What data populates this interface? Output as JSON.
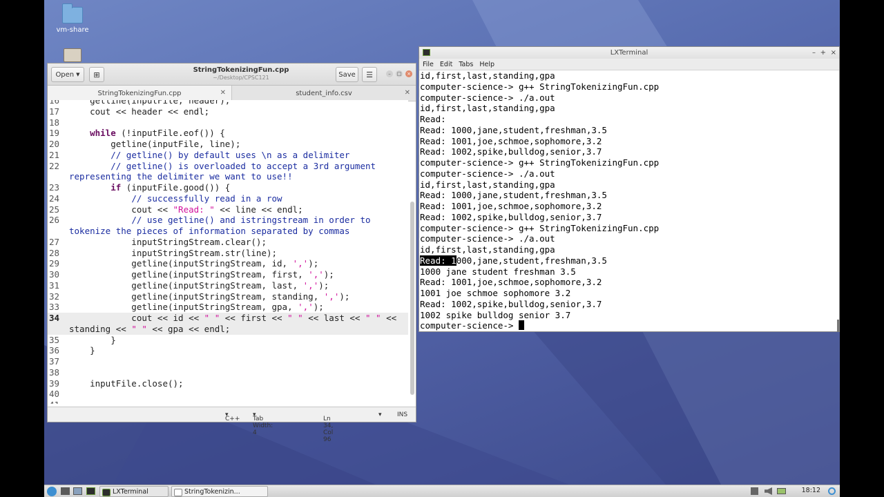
{
  "desktop": {
    "icons": [
      {
        "label": "vm-share",
        "name": "folder-icon"
      }
    ]
  },
  "gedit": {
    "open_label": "Open",
    "title": "StringTokenizingFun.cpp",
    "path": "~/Desktop/CPSC121",
    "save_label": "Save",
    "tabs": [
      {
        "label": "StringTokenizingFun.cpp",
        "active": true
      },
      {
        "label": "student_info.csv",
        "active": false
      }
    ],
    "status": {
      "language": "C++",
      "tab_width": "Tab Width: 4",
      "position": "Ln 34, Col 96",
      "mode": "INS"
    },
    "code_lines": [
      {
        "n": "16",
        "segs": [
          [
            "",
            "    getline(inputFile, header);"
          ]
        ]
      },
      {
        "n": "17",
        "segs": [
          [
            "",
            "    cout << header << endl;"
          ]
        ]
      },
      {
        "n": "18",
        "segs": [
          [
            "",
            ""
          ]
        ]
      },
      {
        "n": "19",
        "segs": [
          [
            "",
            "    "
          ],
          [
            "kw",
            "while"
          ],
          [
            "",
            " (!inputFile.eof()) {"
          ]
        ]
      },
      {
        "n": "20",
        "segs": [
          [
            "",
            "        getline(inputFile, line);"
          ]
        ]
      },
      {
        "n": "21",
        "segs": [
          [
            "",
            "        "
          ],
          [
            "cm",
            "// getline() by default uses \\n as a delimiter"
          ]
        ]
      },
      {
        "n": "22",
        "segs": [
          [
            "",
            "        "
          ],
          [
            "cm",
            "// getline() is overloaded to accept a 3rd argument"
          ]
        ]
      },
      {
        "n": "",
        "segs": [
          [
            "cm",
            "representing the delimiter we want to use!!"
          ]
        ]
      },
      {
        "n": "23",
        "segs": [
          [
            "",
            "        "
          ],
          [
            "kw",
            "if"
          ],
          [
            "",
            " (inputFile.good()) {"
          ]
        ]
      },
      {
        "n": "24",
        "segs": [
          [
            "",
            "            "
          ],
          [
            "cm",
            "// successfully read in a row"
          ]
        ]
      },
      {
        "n": "25",
        "segs": [
          [
            "",
            "            cout << "
          ],
          [
            "st",
            "\"Read: \""
          ],
          [
            "",
            " << line << endl;"
          ]
        ]
      },
      {
        "n": "26",
        "segs": [
          [
            "",
            "            "
          ],
          [
            "cm",
            "// use getline() and istringstream in order to"
          ]
        ]
      },
      {
        "n": "",
        "segs": [
          [
            "cm",
            "tokenize the pieces of information separated by commas"
          ]
        ]
      },
      {
        "n": "27",
        "segs": [
          [
            "",
            "            inputStringStream.clear();"
          ]
        ]
      },
      {
        "n": "28",
        "segs": [
          [
            "",
            "            inputStringStream.str(line);"
          ]
        ]
      },
      {
        "n": "29",
        "segs": [
          [
            "",
            "            getline(inputStringStream, id, "
          ],
          [
            "st",
            "','"
          ],
          [
            "",
            ");"
          ]
        ]
      },
      {
        "n": "30",
        "segs": [
          [
            "",
            "            getline(inputStringStream, first, "
          ],
          [
            "st",
            "','"
          ],
          [
            "",
            ");"
          ]
        ]
      },
      {
        "n": "31",
        "segs": [
          [
            "",
            "            getline(inputStringStream, last, "
          ],
          [
            "st",
            "','"
          ],
          [
            "",
            ");"
          ]
        ]
      },
      {
        "n": "32",
        "segs": [
          [
            "",
            "            getline(inputStringStream, standing, "
          ],
          [
            "st",
            "','"
          ],
          [
            "",
            ");"
          ]
        ]
      },
      {
        "n": "33",
        "segs": [
          [
            "",
            "            getline(inputStringStream, gpa, "
          ],
          [
            "st",
            "','"
          ],
          [
            "",
            ");"
          ]
        ]
      },
      {
        "n": "34",
        "cur": true,
        "segs": [
          [
            "",
            "            cout << id << "
          ],
          [
            "st",
            "\" \""
          ],
          [
            "",
            " << first << "
          ],
          [
            "st",
            "\" \""
          ],
          [
            "",
            " << last << "
          ],
          [
            "st",
            "\" \""
          ],
          [
            "",
            " <<"
          ]
        ]
      },
      {
        "n": "",
        "cur": true,
        "segs": [
          [
            "",
            "standing << "
          ],
          [
            "st",
            "\" \""
          ],
          [
            "",
            " << gpa << endl;"
          ]
        ]
      },
      {
        "n": "35",
        "segs": [
          [
            "",
            "        }"
          ]
        ]
      },
      {
        "n": "36",
        "segs": [
          [
            "",
            "    }"
          ]
        ]
      },
      {
        "n": "37",
        "segs": [
          [
            "",
            ""
          ]
        ]
      },
      {
        "n": "38",
        "segs": [
          [
            "",
            ""
          ]
        ]
      },
      {
        "n": "39",
        "segs": [
          [
            "",
            "    inputFile.close();"
          ]
        ]
      },
      {
        "n": "40",
        "segs": [
          [
            "",
            ""
          ]
        ]
      },
      {
        "n": "41",
        "segs": [
          [
            "",
            ""
          ]
        ]
      }
    ]
  },
  "terminal": {
    "title": "LXTerminal",
    "menu": [
      "File",
      "Edit",
      "Tabs",
      "Help"
    ],
    "lines": [
      "id,first,last,standing,gpa",
      "computer-science-> g++ StringTokenizingFun.cpp",
      "computer-science-> ./a.out",
      "id,first,last,standing,gpa",
      "Read:",
      "Read: 1000,jane,student,freshman,3.5",
      "Read: 1001,joe,schmoe,sophomore,3.2",
      "Read: 1002,spike,bulldog,senior,3.7",
      "computer-science-> g++ StringTokenizingFun.cpp",
      "computer-science-> ./a.out",
      "id,first,last,standing,gpa",
      "Read: 1000,jane,student,freshman,3.5",
      "Read: 1001,joe,schmoe,sophomore,3.2",
      "Read: 1002,spike,bulldog,senior,3.7",
      "computer-science-> g++ StringTokenizingFun.cpp",
      "computer-science-> ./a.out",
      "id,first,last,standing,gpa",
      "Read: 1000,jane,student,freshman,3.5",
      "1000 jane student freshman 3.5",
      "Read: 1001,joe,schmoe,sophomore,3.2",
      "1001 joe schmoe sophomore 3.2",
      "Read: 1002,spike,bulldog,senior,3.7",
      "1002 spike bulldog senior 3.7",
      "computer-science-> "
    ],
    "selection": {
      "line": 17,
      "chars": 7
    },
    "cursor_line": 23
  },
  "taskbar": {
    "tasks": [
      {
        "label": "LXTerminal",
        "name": "taskbar-lxterminal"
      },
      {
        "label": "StringTokenizin...",
        "name": "taskbar-gedit"
      }
    ],
    "clock": "18:12"
  },
  "colors": {
    "keyword": "#6a0d61",
    "comment": "#1a2ca0",
    "string": "#d1119c",
    "desktop": "#5a6fb2"
  }
}
